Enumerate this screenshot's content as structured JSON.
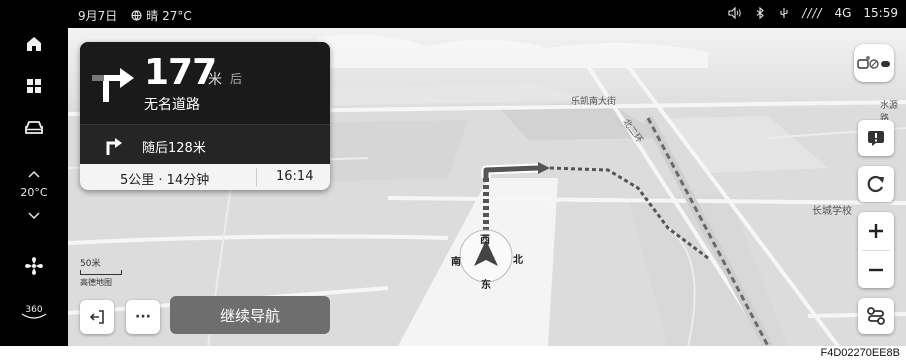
{
  "status": {
    "date": "9月7日",
    "weather": "晴 27°C",
    "network": "4G",
    "signal_text": "////",
    "time": "15:59"
  },
  "sidebar": {
    "temperature": "20°C"
  },
  "nav": {
    "distance": "177",
    "unit": "米",
    "after": "后",
    "road": "无名道路",
    "then_text": "随后128米",
    "remaining": "5公里 · 14分钟",
    "arrival": "16:14"
  },
  "map": {
    "labels": {
      "street1": "乐凯南大街",
      "street2": "水源路",
      "street3": "北二环",
      "poi": "长城学校"
    },
    "compass": {
      "n": "北",
      "s": "南",
      "e": "东",
      "w": "西"
    },
    "scale": "50米",
    "brand": "高德地图"
  },
  "controls": {
    "continue_label": "继续导航",
    "more_label": "···"
  },
  "footer_code": "F4D02270EE8B",
  "colors": {
    "card_bg": "#1a1a1a",
    "map_bg": "#dedede",
    "route": "#444444"
  }
}
